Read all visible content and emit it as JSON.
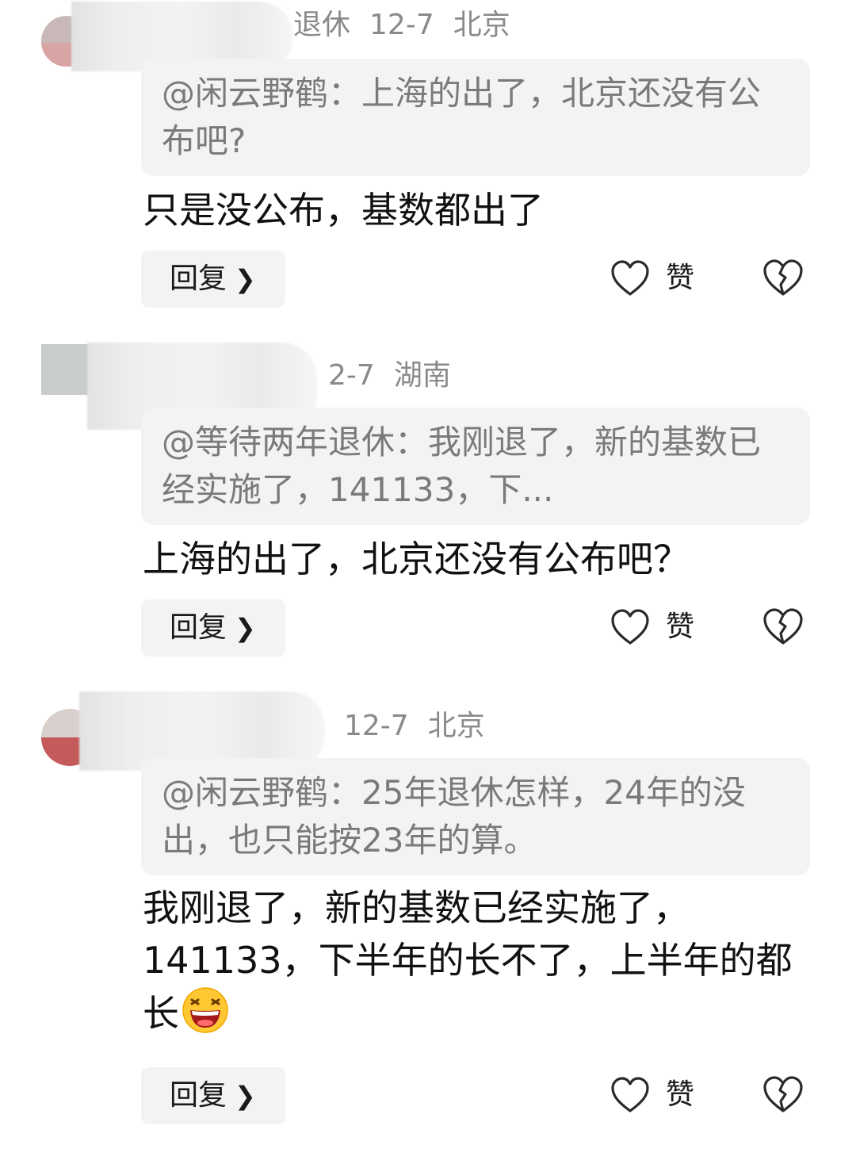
{
  "comments": [
    {
      "meta": {
        "name_tail": "退休",
        "date": "12-7",
        "location": "北京"
      },
      "quote": "@闲云野鹤：上海的出了，北京还没有公布吧?",
      "body": "只是没公布，基数都出了",
      "reply_label": "回复",
      "like_label": "赞"
    },
    {
      "meta": {
        "name_tail": "",
        "date": "2-7",
        "location": "湖南"
      },
      "quote": "@等待两年退休：我刚退了，新的基数已经实施了，141133，下...",
      "body": "上海的出了，北京还没有公布吧？",
      "reply_label": "回复",
      "like_label": "赞"
    },
    {
      "meta": {
        "name_tail": "",
        "date": "12-7",
        "location": "北京"
      },
      "quote": "@闲云野鹤：25年退休怎样，24年的没出，也只能按23年的算。",
      "body": "我刚退了，新的基数已经实施了，141133，下半年的长不了，上半年的都长",
      "body_emoji": "grinning-laugh-emoji",
      "reply_label": "回复",
      "like_label": "赞"
    }
  ],
  "colors": {
    "background": "#ffffff",
    "quote_bg": "#f3f3f3",
    "meta_text": "#8a8a8a",
    "body_text": "#111111"
  },
  "icons": {
    "reply_chevron": "chevron-right-icon",
    "like": "heart-outline-icon",
    "dislike": "broken-heart-icon"
  }
}
